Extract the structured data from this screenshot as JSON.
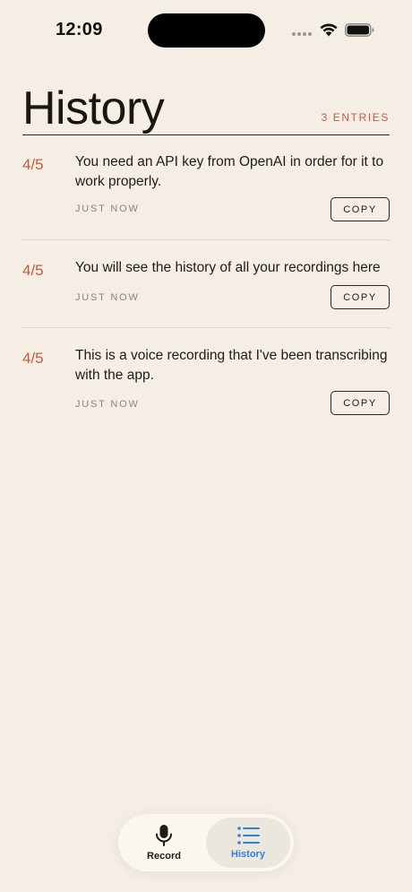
{
  "status_bar": {
    "time": "12:09"
  },
  "header": {
    "title": "History",
    "entries_count": "3 ENTRIES"
  },
  "history": {
    "items": [
      {
        "date": "4/5",
        "text": "You need an API key from OpenAI in order for it to work properly.",
        "time": "JUST NOW",
        "copy_label": "COPY"
      },
      {
        "date": "4/5",
        "text": "You will see the history of all your recordings here",
        "time": "JUST NOW",
        "copy_label": "COPY"
      },
      {
        "date": "4/5",
        "text": "This is a voice recording that I've been transcribing with the app.",
        "time": "JUST NOW",
        "copy_label": "COPY"
      }
    ]
  },
  "tab_bar": {
    "tabs": [
      {
        "label": "Record",
        "icon": "microphone-icon",
        "active": false
      },
      {
        "label": "History",
        "icon": "list-icon",
        "active": true
      }
    ]
  },
  "colors": {
    "background": "#f4eee4",
    "accent": "#c35a42",
    "active_tab": "#2f7ee0",
    "text": "#1f1b16"
  }
}
